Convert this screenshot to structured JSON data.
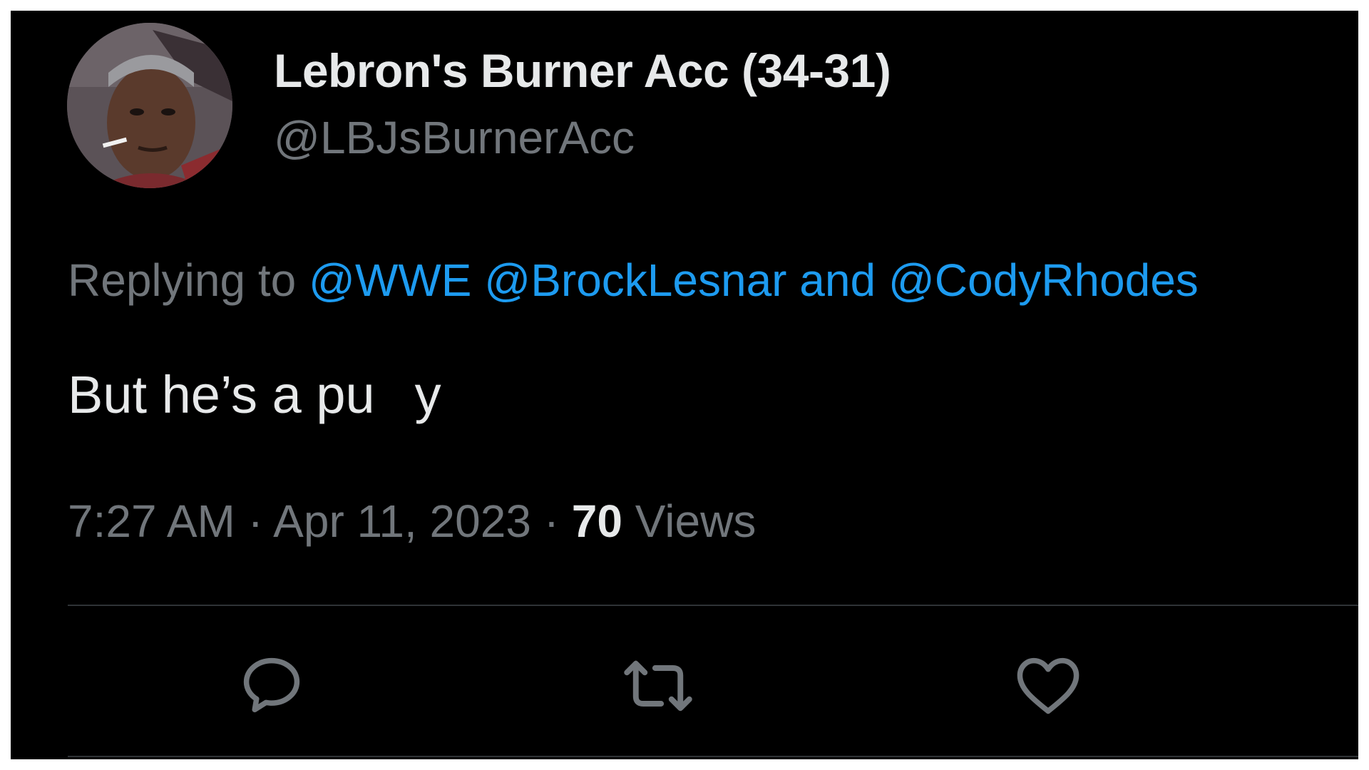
{
  "tweet": {
    "display_name": "Lebron's Burner Acc (34-31)",
    "handle": "@LBJsBurnerAcc",
    "replying": {
      "prefix": "Replying to",
      "mention_1": "@WWE",
      "mention_2": "@BrockLesnar",
      "conjunction": "and",
      "mention_3": "@CodyRhodes"
    },
    "text_start": "But he’s a pu",
    "text_end": "y",
    "time": "7:27 AM",
    "separator": "·",
    "date": "Apr 11, 2023",
    "views_count": "70",
    "views_label": "Views"
  },
  "actions": {
    "reply_icon": "comment-bubble-icon",
    "retweet_icon": "retweet-arrows-icon",
    "like_icon": "heart-outline-icon"
  },
  "colors": {
    "background": "#000000",
    "primary_text": "#e7e9ea",
    "secondary_text": "#71767b",
    "link": "#1d9bf0",
    "divider": "#2f3336"
  }
}
